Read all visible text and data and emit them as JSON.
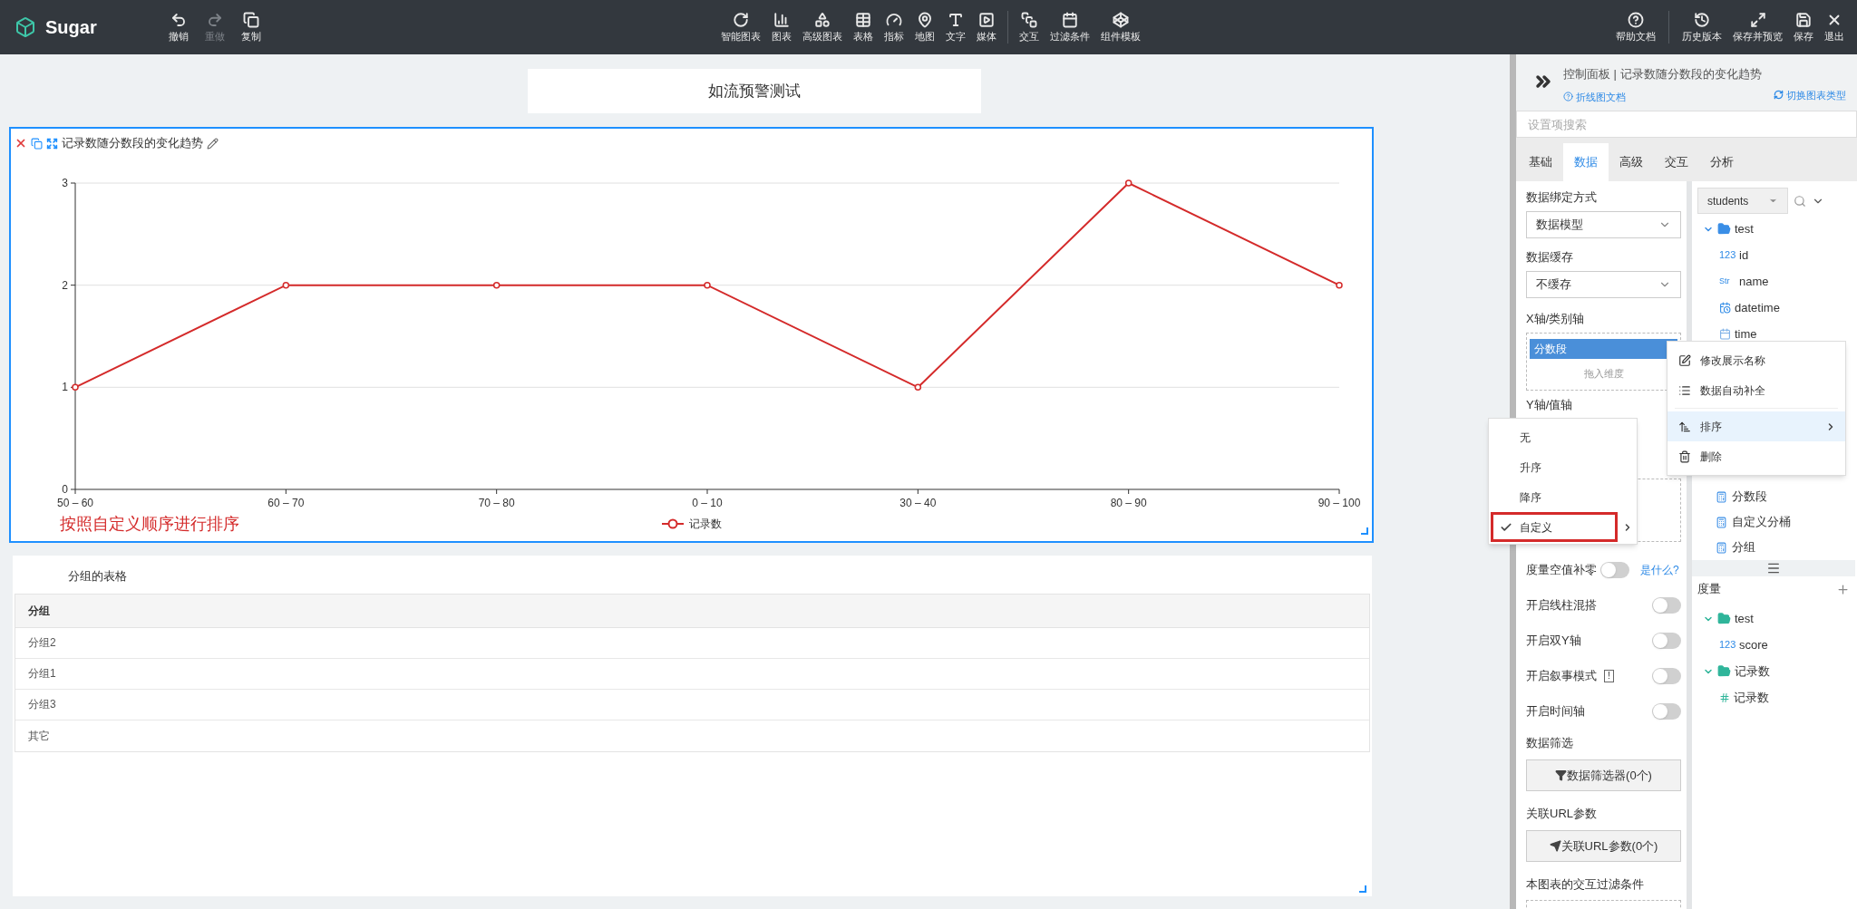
{
  "toolbar": {
    "logo": "Sugar",
    "edit_actions": [
      {
        "label": "撤销",
        "disabled": false
      },
      {
        "label": "重做",
        "disabled": true
      },
      {
        "label": "复制",
        "disabled": false
      }
    ],
    "insert_items": [
      "智能图表",
      "图表",
      "高级图表",
      "表格",
      "指标",
      "地图",
      "文字",
      "媒体"
    ],
    "panel_items": [
      "交互",
      "过滤条件",
      "组件模板"
    ],
    "help_item": "帮助文档",
    "file_actions": [
      "历史版本",
      "保存并预览",
      "保存",
      "退出"
    ]
  },
  "page_title": "如流预警测试",
  "chart_card": {
    "title": "记录数随分数段的变化趋势",
    "note": "按照自定义顺序进行排序",
    "chart_data": {
      "type": "line",
      "categories": [
        "50 – 60",
        "60 – 70",
        "70 – 80",
        "0 – 10",
        "30 – 40",
        "80 – 90",
        "90 – 100"
      ],
      "series": [
        {
          "name": "记录数",
          "color": "#d42a2a",
          "marker": "circle",
          "values": [
            1,
            2,
            2,
            2,
            1,
            3,
            2
          ]
        }
      ],
      "ylim": [
        0,
        3
      ],
      "yticks": [
        0,
        1,
        2,
        3
      ]
    }
  },
  "table_card": {
    "title": "分组的表格",
    "columns": [
      "分组"
    ],
    "rows": [
      [
        "分组2"
      ],
      [
        "分组1"
      ],
      [
        "分组3"
      ],
      [
        "其它"
      ]
    ]
  },
  "control_panel": {
    "title": "控制面板 | 记录数随分数段的变化趋势",
    "doc_link": "折线图文档",
    "switch_link": "切换图表类型",
    "search": {
      "placeholder": "设置项搜索"
    },
    "tabs": [
      {
        "label": "基础",
        "selected": false
      },
      {
        "label": "数据",
        "selected": true
      },
      {
        "label": "高级",
        "selected": false
      },
      {
        "label": "交互",
        "selected": false
      },
      {
        "label": "分析",
        "selected": false
      }
    ],
    "settings": {
      "binding": {
        "label": "数据绑定方式",
        "value": "数据模型"
      },
      "cache": {
        "label": "数据缓存",
        "value": "不缓存"
      },
      "x_axis": {
        "label": "X轴/类别轴",
        "chips": [
          "分数段"
        ],
        "placeholder": "拖入维度"
      },
      "y_axis": {
        "label": "Y轴/值轴"
      },
      "toggles": [
        {
          "label": "度量空值补零",
          "on": false,
          "help": "是什么?"
        },
        {
          "label": "开启线柱混搭",
          "on": false
        },
        {
          "label": "开启双Y轴",
          "on": false
        },
        {
          "label": "开启叙事模式",
          "on": false,
          "info": "!"
        },
        {
          "label": "开启时间轴",
          "on": false
        }
      ],
      "filter": {
        "label": "数据筛选",
        "button": "数据筛选器(0个)"
      },
      "url_params": {
        "label": "关联URL参数",
        "button": "关联URL参数(0个)"
      },
      "interaction_filter": {
        "label": "本图表的交互过滤条件"
      }
    },
    "fields": {
      "source": "students",
      "dimensions": {
        "folder": "test",
        "expanded": true,
        "items": [
          {
            "name": "id",
            "kind": "number",
            "badge": "123"
          },
          {
            "name": "name",
            "kind": "string",
            "badge": "Str"
          },
          {
            "name": "datetime",
            "kind": "datetime"
          },
          {
            "name": "time",
            "kind": "time"
          }
        ]
      },
      "computed": [
        {
          "name": "分数段"
        },
        {
          "name": "自定义分桶"
        },
        {
          "name": "分组"
        }
      ],
      "measures_title": "度量",
      "measures": [
        {
          "folder": "test",
          "expanded": true,
          "items": [
            {
              "name": "score",
              "kind": "number",
              "badge": "123"
            }
          ]
        },
        {
          "folder": "记录数",
          "expanded": true,
          "items": [
            {
              "name": "记录数",
              "kind": "count"
            }
          ]
        }
      ]
    }
  },
  "context_menu": {
    "items": [
      {
        "label": "修改展示名称",
        "highlighted": false,
        "has_submenu": false
      },
      {
        "label": "数据自动补全",
        "highlighted": false,
        "has_submenu": false
      },
      {
        "label": "排序",
        "highlighted": true,
        "has_submenu": true
      },
      {
        "label": "删除",
        "highlighted": false,
        "has_submenu": false
      }
    ]
  },
  "sort_submenu": {
    "items": [
      {
        "label": "无",
        "selected": false,
        "has_submenu": false,
        "outlined": false
      },
      {
        "label": "升序",
        "selected": false,
        "has_submenu": false,
        "outlined": false
      },
      {
        "label": "降序",
        "selected": false,
        "has_submenu": false,
        "outlined": false
      },
      {
        "label": "自定义",
        "selected": true,
        "has_submenu": true,
        "outlined": true
      }
    ]
  }
}
